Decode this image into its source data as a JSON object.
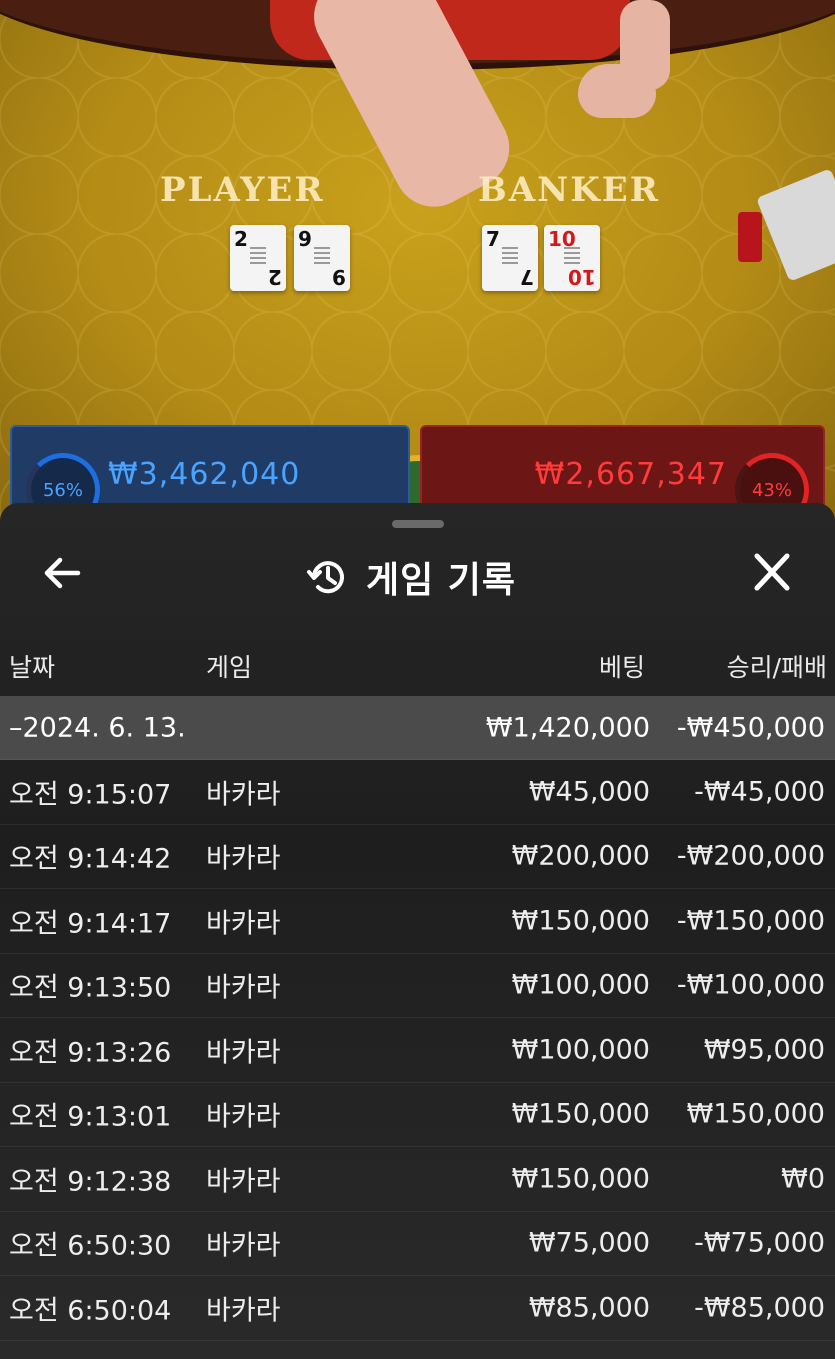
{
  "table": {
    "player_label": "PLAYER",
    "banker_label": "BANKER",
    "player_cards": [
      {
        "rank": "2",
        "suit": "♠",
        "color": "black"
      },
      {
        "rank": "9",
        "suit": "♣",
        "color": "black"
      }
    ],
    "banker_cards": [
      {
        "rank": "7",
        "suit": "♣",
        "color": "black"
      },
      {
        "rank": "10",
        "suit": "♥",
        "color": "red"
      }
    ]
  },
  "bets": {
    "player": {
      "percent": "56%",
      "amount": "₩3,462,040"
    },
    "banker": {
      "percent": "43%",
      "amount": "₩2,667,347"
    }
  },
  "sheet": {
    "title": "게임 기록",
    "icons": {
      "back": "arrow-left-icon",
      "history": "history-icon",
      "close": "close-icon"
    },
    "columns": {
      "date": "날짜",
      "game": "게임",
      "bet": "베팅",
      "result": "승리/패배"
    },
    "date_group": {
      "date": "–2024. 6. 13.",
      "bet": "₩1,420,000",
      "result": "-₩450,000"
    },
    "rows": [
      {
        "time": "오전 9:15:07",
        "game": "바카라",
        "bet": "₩45,000",
        "result": "-₩45,000"
      },
      {
        "time": "오전 9:14:42",
        "game": "바카라",
        "bet": "₩200,000",
        "result": "-₩200,000"
      },
      {
        "time": "오전 9:14:17",
        "game": "바카라",
        "bet": "₩150,000",
        "result": "-₩150,000"
      },
      {
        "time": "오전 9:13:50",
        "game": "바카라",
        "bet": "₩100,000",
        "result": "-₩100,000"
      },
      {
        "time": "오전 9:13:26",
        "game": "바카라",
        "bet": "₩100,000",
        "result": "₩95,000"
      },
      {
        "time": "오전 9:13:01",
        "game": "바카라",
        "bet": "₩150,000",
        "result": "₩150,000"
      },
      {
        "time": "오전 9:12:38",
        "game": "바카라",
        "bet": "₩150,000",
        "result": "₩0"
      },
      {
        "time": "오전 6:50:30",
        "game": "바카라",
        "bet": "₩75,000",
        "result": "-₩75,000"
      },
      {
        "time": "오전 6:50:04",
        "game": "바카라",
        "bet": "₩85,000",
        "result": "-₩85,000"
      }
    ]
  },
  "colors": {
    "player_blue": "#4aa3ff",
    "banker_red": "#ff3b3b",
    "felt": "#b48c16",
    "sheet_bg": "#262626"
  }
}
